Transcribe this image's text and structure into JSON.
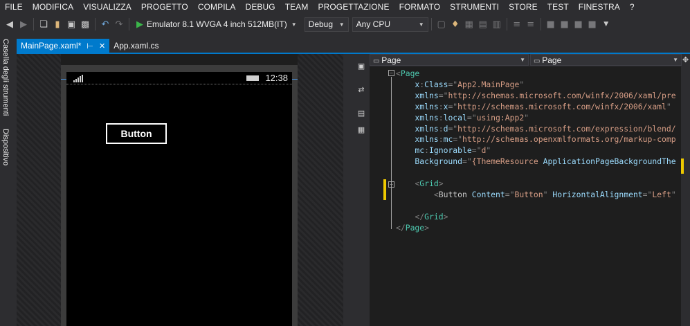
{
  "menu": [
    "FILE",
    "MODIFICA",
    "VISUALIZZA",
    "PROGETTO",
    "COMPILA",
    "DEBUG",
    "TEAM",
    "PROGETTAZIONE",
    "FORMATO",
    "STRUMENTI",
    "STORE",
    "TEST",
    "FINESTRA",
    "?"
  ],
  "toolbar": {
    "run_target": "Emulator 8.1 WVGA 4 inch 512MB(IT)",
    "config": "Debug",
    "platform": "Any CPU"
  },
  "side_tabs": [
    "Casella degli strumenti",
    "Dispositivo"
  ],
  "tabs": [
    {
      "label": "MainPage.xaml*",
      "active": true
    },
    {
      "label": "App.xaml.cs",
      "active": false
    }
  ],
  "designer": {
    "clock": "12:38",
    "button_label": "Button"
  },
  "nav": {
    "left": "Page",
    "right": "Page"
  },
  "code": [
    {
      "tokens": [
        {
          "t": "punct",
          "v": "<"
        },
        {
          "t": "name",
          "v": "Page"
        }
      ]
    },
    {
      "tokens": [
        {
          "t": "attr",
          "v": "    x"
        },
        {
          "t": "punct",
          "v": ":"
        },
        {
          "t": "attr",
          "v": "Class"
        },
        {
          "t": "punct",
          "v": "=\""
        },
        {
          "t": "val",
          "v": "App2.MainPage"
        },
        {
          "t": "punct",
          "v": "\""
        }
      ]
    },
    {
      "tokens": [
        {
          "t": "attr",
          "v": "    xmlns"
        },
        {
          "t": "punct",
          "v": "=\""
        },
        {
          "t": "val",
          "v": "http://schemas.microsoft.com/winfx/2006/xaml/pre"
        }
      ]
    },
    {
      "tokens": [
        {
          "t": "attr",
          "v": "    xmlns"
        },
        {
          "t": "punct",
          "v": ":"
        },
        {
          "t": "attr",
          "v": "x"
        },
        {
          "t": "punct",
          "v": "=\""
        },
        {
          "t": "val",
          "v": "http://schemas.microsoft.com/winfx/2006/xaml"
        },
        {
          "t": "punct",
          "v": "\""
        }
      ]
    },
    {
      "tokens": [
        {
          "t": "attr",
          "v": "    xmlns"
        },
        {
          "t": "punct",
          "v": ":"
        },
        {
          "t": "attr",
          "v": "local"
        },
        {
          "t": "punct",
          "v": "=\""
        },
        {
          "t": "val",
          "v": "using:App2"
        },
        {
          "t": "punct",
          "v": "\""
        }
      ]
    },
    {
      "tokens": [
        {
          "t": "attr",
          "v": "    xmlns"
        },
        {
          "t": "punct",
          "v": ":"
        },
        {
          "t": "attr",
          "v": "d"
        },
        {
          "t": "punct",
          "v": "=\""
        },
        {
          "t": "val",
          "v": "http://schemas.microsoft.com/expression/blend/"
        }
      ]
    },
    {
      "tokens": [
        {
          "t": "attr",
          "v": "    xmlns"
        },
        {
          "t": "punct",
          "v": ":"
        },
        {
          "t": "attr",
          "v": "mc"
        },
        {
          "t": "punct",
          "v": "=\""
        },
        {
          "t": "val",
          "v": "http://schemas.openxmlformats.org/markup-comp"
        }
      ]
    },
    {
      "tokens": [
        {
          "t": "attr",
          "v": "    mc"
        },
        {
          "t": "punct",
          "v": ":"
        },
        {
          "t": "attr",
          "v": "Ignorable"
        },
        {
          "t": "punct",
          "v": "=\""
        },
        {
          "t": "val",
          "v": "d"
        },
        {
          "t": "punct",
          "v": "\""
        }
      ]
    },
    {
      "tokens": [
        {
          "t": "attr",
          "v": "    Background"
        },
        {
          "t": "punct",
          "v": "=\""
        },
        {
          "t": "val",
          "v": "{ThemeResource "
        },
        {
          "t": "attr",
          "v": "ApplicationPageBackgroundThe"
        }
      ]
    },
    {
      "tokens": []
    },
    {
      "tokens": [
        {
          "t": "plain",
          "v": "    "
        },
        {
          "t": "punct",
          "v": "<"
        },
        {
          "t": "name",
          "v": "Grid"
        },
        {
          "t": "punct",
          "v": ">"
        }
      ]
    },
    {
      "tokens": [
        {
          "t": "plain",
          "v": "        "
        },
        {
          "t": "punct",
          "v": "<"
        },
        {
          "t": "str",
          "v": "Button"
        },
        {
          "t": "attr",
          "v": " Content"
        },
        {
          "t": "punct",
          "v": "=\""
        },
        {
          "t": "val",
          "v": "Button"
        },
        {
          "t": "punct",
          "v": "\""
        },
        {
          "t": "attr",
          "v": " HorizontalAlignment"
        },
        {
          "t": "punct",
          "v": "=\""
        },
        {
          "t": "val",
          "v": "Left"
        },
        {
          "t": "punct",
          "v": "\""
        }
      ]
    },
    {
      "tokens": []
    },
    {
      "tokens": [
        {
          "t": "plain",
          "v": "    "
        },
        {
          "t": "punct",
          "v": "</"
        },
        {
          "t": "name",
          "v": "Grid"
        },
        {
          "t": "punct",
          "v": ">"
        }
      ]
    },
    {
      "tokens": [
        {
          "t": "punct",
          "v": "</"
        },
        {
          "t": "name",
          "v": "Page"
        },
        {
          "t": "punct",
          "v": ">"
        }
      ]
    }
  ]
}
